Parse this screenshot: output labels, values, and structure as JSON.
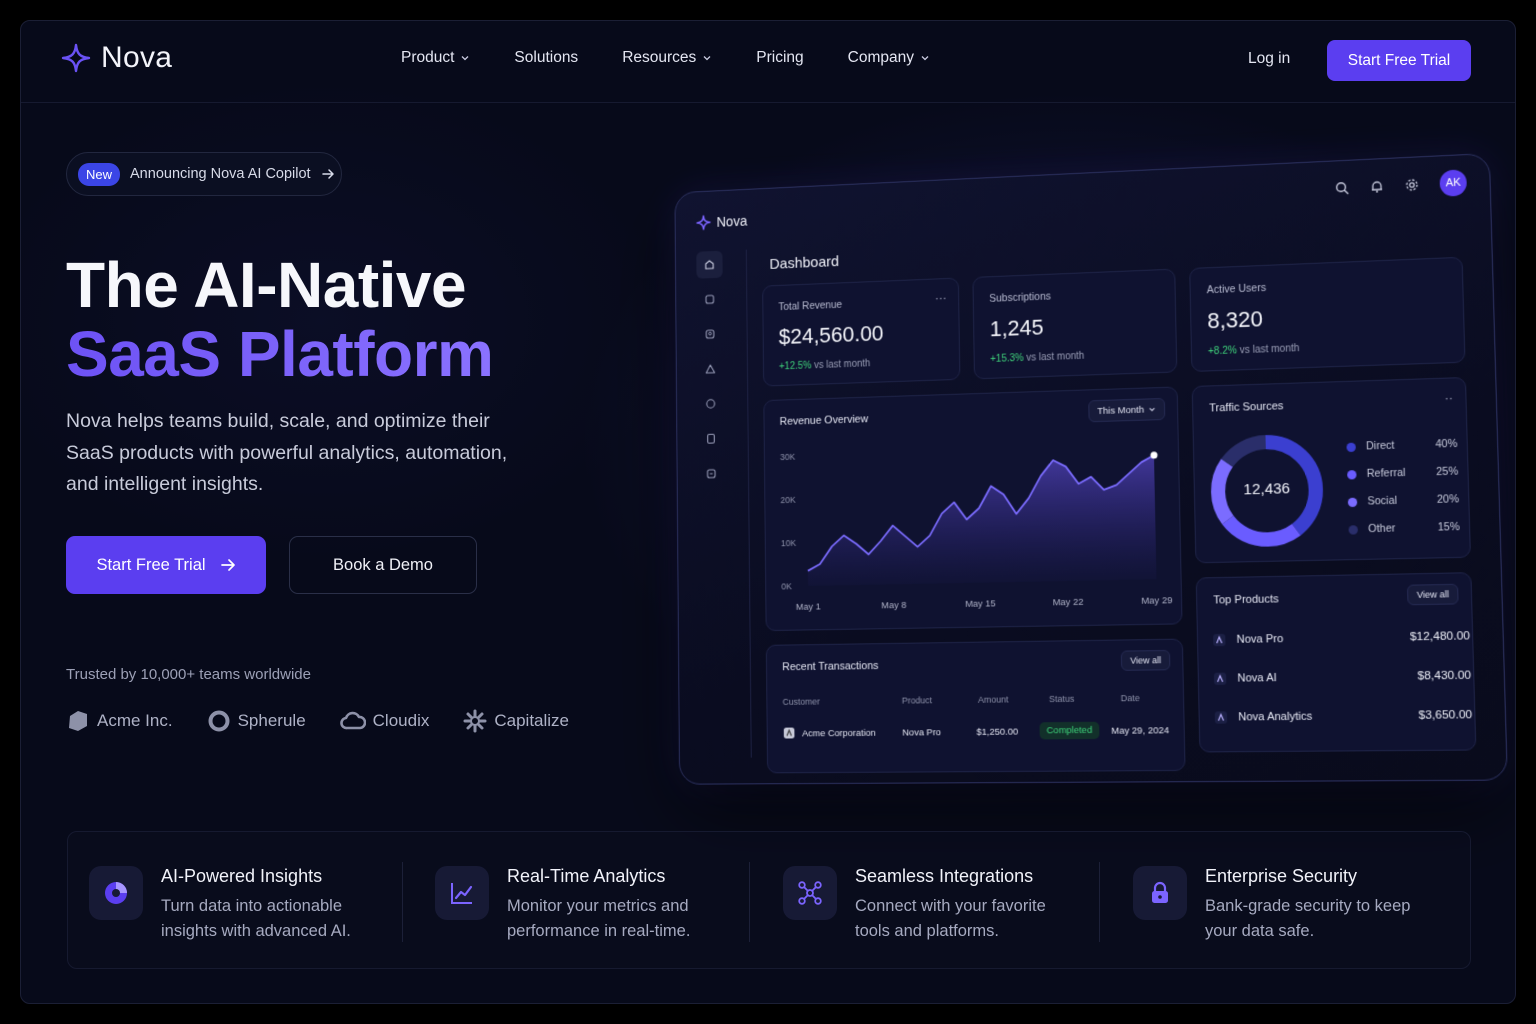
{
  "nav": {
    "brand": "Nova",
    "items": [
      {
        "label": "Product",
        "dropdown": true
      },
      {
        "label": "Solutions",
        "dropdown": false
      },
      {
        "label": "Resources",
        "dropdown": true
      },
      {
        "label": "Pricing",
        "dropdown": false
      },
      {
        "label": "Company",
        "dropdown": true
      }
    ],
    "login": "Log in",
    "cta": "Start Free Trial"
  },
  "hero": {
    "badge": "New",
    "announcement": "Announcing Nova AI Copilot",
    "title_line1": "The AI-Native",
    "title_line2": "SaaS Platform",
    "subtitle": "Nova helps teams build, scale, and optimize their SaaS products with powerful analytics, automation, and intelligent insights.",
    "primary_cta": "Start Free Trial",
    "secondary_cta": "Book a Demo",
    "trusted": "Trusted by 10,000+ teams worldwide",
    "logos": [
      "Acme Inc.",
      "Spherule",
      "Cloudix",
      "Capitalize"
    ]
  },
  "dashboard": {
    "brand": "Nova",
    "avatar": "AK",
    "title": "Dashboard",
    "kpis": [
      {
        "label": "Total Revenue",
        "value": "$24,560.00",
        "delta": "+12.5%",
        "delta_suffix": "vs last month"
      },
      {
        "label": "Subscriptions",
        "value": "1,245",
        "delta": "+15.3%",
        "delta_suffix": "vs last month"
      },
      {
        "label": "Active Users",
        "value": "8,320",
        "delta": "+8.2%",
        "delta_suffix": "vs last month"
      }
    ],
    "revenue_overview": {
      "title": "Revenue Overview",
      "range": "This Month"
    },
    "traffic": {
      "title": "Traffic Sources",
      "total": "12,436",
      "sources": [
        {
          "name": "Direct",
          "pct": "40%",
          "color": "#3b3fd0"
        },
        {
          "name": "Referral",
          "pct": "25%",
          "color": "#6a5cff"
        },
        {
          "name": "Social",
          "pct": "20%",
          "color": "#7b6cff"
        },
        {
          "name": "Other",
          "pct": "15%",
          "color": "#2a2e6a"
        }
      ]
    },
    "top_products": {
      "title": "Top Products",
      "view_all": "View all",
      "items": [
        {
          "name": "Nova Pro",
          "value": "$12,480.00"
        },
        {
          "name": "Nova AI",
          "value": "$8,430.00"
        },
        {
          "name": "Nova Analytics",
          "value": "$3,650.00"
        }
      ]
    },
    "transactions": {
      "title": "Recent Transactions",
      "view_all": "View all",
      "headers": [
        "Customer",
        "Product",
        "Amount",
        "Status",
        "Date"
      ],
      "rows": [
        {
          "customer": "Acme Corporation",
          "product": "Nova Pro",
          "amount": "$1,250.00",
          "status": "Completed",
          "date": "May 29, 2024"
        }
      ]
    }
  },
  "chart_data": {
    "type": "area",
    "title": "Revenue Overview",
    "x_ticks": [
      "May 1",
      "May 8",
      "May 15",
      "May 22",
      "May 29"
    ],
    "y_ticks": [
      "0K",
      "10K",
      "20K",
      "30K"
    ],
    "ylim": [
      0,
      30000
    ],
    "x": [
      1,
      2,
      3,
      4,
      5,
      6,
      7,
      8,
      9,
      10,
      11,
      12,
      13,
      14,
      15,
      16,
      17,
      18,
      19,
      20,
      21,
      22,
      23,
      24,
      25,
      26,
      27,
      28,
      29
    ],
    "series": [
      {
        "values": [
          3500,
          5000,
          9000,
          11500,
          9500,
          7000,
          10000,
          13500,
          11000,
          8500,
          11000,
          16000,
          18500,
          14500,
          17000,
          22000,
          20000,
          15500,
          19000,
          24000,
          27500,
          26000,
          22000,
          23500,
          20500,
          21500,
          24000,
          26500,
          28000
        ]
      }
    ],
    "color": "#7b6cff",
    "grid": false
  },
  "features": [
    {
      "title": "AI-Powered Insights",
      "desc": "Turn data into actionable insights with advanced AI.",
      "icon": "ai-insights-icon"
    },
    {
      "title": "Real-Time Analytics",
      "desc": "Monitor your metrics and performance in real-time.",
      "icon": "trend-chart-icon"
    },
    {
      "title": "Seamless Integrations",
      "desc": "Connect with your favorite tools and platforms.",
      "icon": "integrations-icon"
    },
    {
      "title": "Enterprise Security",
      "desc": "Bank-grade security to keep your data safe.",
      "icon": "lock-icon"
    }
  ],
  "colors": {
    "accent": "#5b3ef0",
    "background": "#070a1a",
    "success": "#3fd47b"
  }
}
